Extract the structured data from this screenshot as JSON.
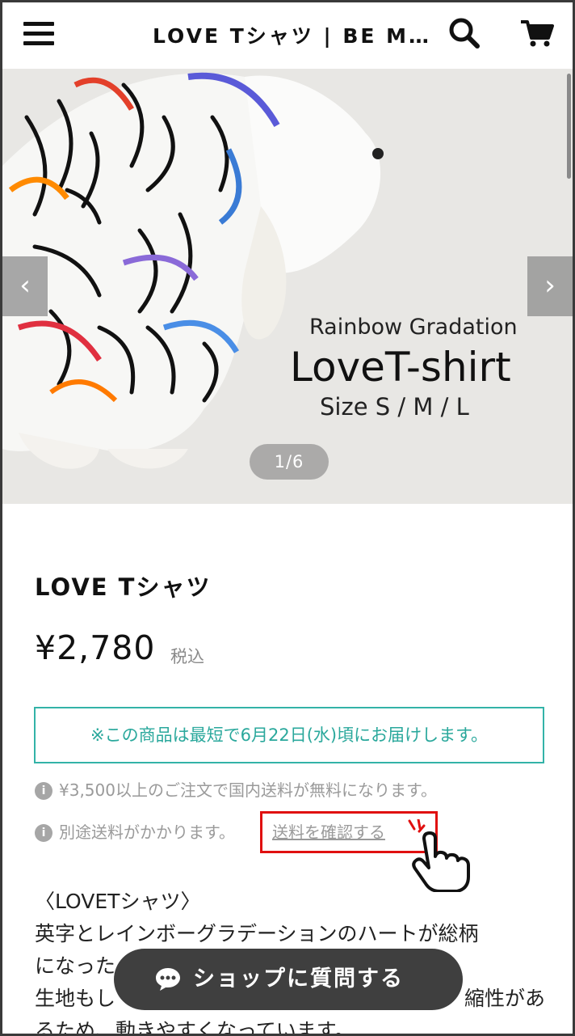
{
  "header": {
    "title": "LOVE Tシャツ | BE M…",
    "menu_icon": "hamburger-menu-icon",
    "search_icon": "search-icon",
    "cart_icon": "shopping-cart-icon"
  },
  "gallery": {
    "counter": "1/6",
    "image_text": {
      "line1": "Rainbow Gradation",
      "line2": "LoveT-shirt",
      "line3": "Size S / M / L"
    }
  },
  "product": {
    "title": "LOVE Tシャツ",
    "price": "¥2,780",
    "tax_label": "税込",
    "delivery_notice": "※この商品は最短で6月22日(水)頃にお届けします。",
    "free_shipping_note": "¥3,500以上のご注文で国内送料が無料になります。",
    "shipping_note": "別途送料がかかります。",
    "shipping_link": "送料を確認する"
  },
  "description": {
    "heading": "〈LOVETシャツ〉",
    "line1": "英字とレインボーグラデーションのハートが総柄",
    "line2": "になった",
    "line3": "生地もし",
    "line3_right": "縮性があ",
    "line4": "るため、動きやすくなっています。"
  },
  "chat_button": {
    "label": "ショップに質問する"
  },
  "colors": {
    "accent_teal": "#33b3a8",
    "highlight_red": "#e01010",
    "chat_bg": "#3f3f3f"
  }
}
